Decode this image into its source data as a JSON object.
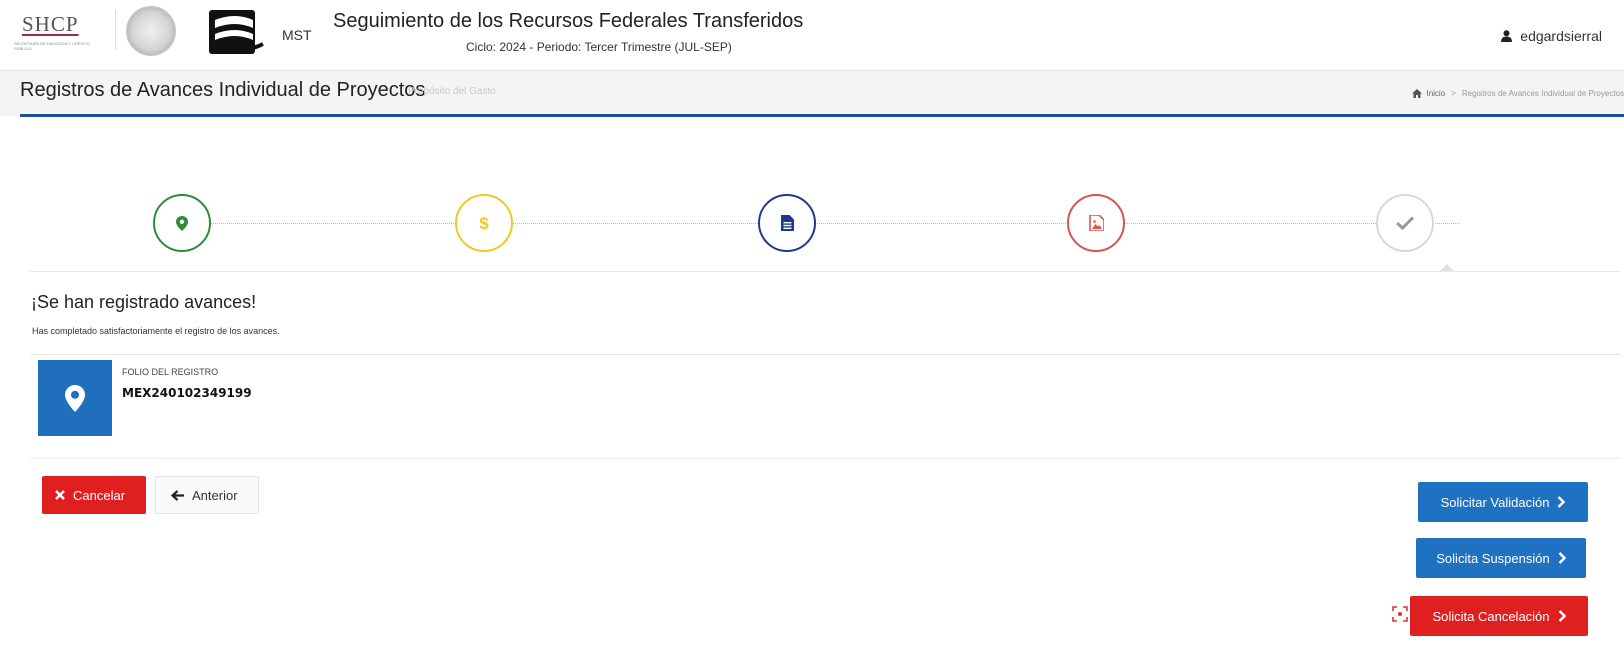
{
  "header": {
    "org_name": "SHCP",
    "org_subtitle": "SECRETARÍA DE HACIENDA Y CRÉDITO PÚBLICO",
    "system_abbr": "MST",
    "app_title": "Seguimiento de los Recursos Federales Transferidos",
    "app_subtitle": "Ciclo: 2024 - Periodo: Tercer Trimestre (JUL-SEP)",
    "username": "edgardsierral"
  },
  "page": {
    "title": "Registros de Avances Individual de Proyectos",
    "subtitle": "Propósito del Gasto",
    "breadcrumb": [
      "Inicio",
      "Registros de Avances Individual de Proyectos"
    ]
  },
  "steps": [
    {
      "icon": "map-marker-icon",
      "color": "#2e8b3a",
      "state": "done"
    },
    {
      "icon": "dollar-icon",
      "color": "#f2c81f",
      "state": "done"
    },
    {
      "icon": "document-icon",
      "color": "#1e3a8a",
      "state": "done"
    },
    {
      "icon": "image-icon",
      "color": "#d9534f",
      "state": "done"
    },
    {
      "icon": "check-icon",
      "color": "#999999",
      "state": "active"
    }
  ],
  "result": {
    "title": "¡Se han registrado avances!",
    "message": "Has completado satisfactoriamente el registro de los avances.",
    "folio_label": "FOLIO DEL REGISTRO",
    "folio_value": "MEX240102349199"
  },
  "buttons": {
    "cancel": "Cancelar",
    "previous": "Anterior",
    "request_validation": "Solicitar Validación",
    "request_suspension": "Solicita Suspensión",
    "request_cancellation": "Solicita Cancelación"
  },
  "colors": {
    "primary": "#1f72c1",
    "danger": "#e02020",
    "heading_rule": "#1e4f9a"
  }
}
